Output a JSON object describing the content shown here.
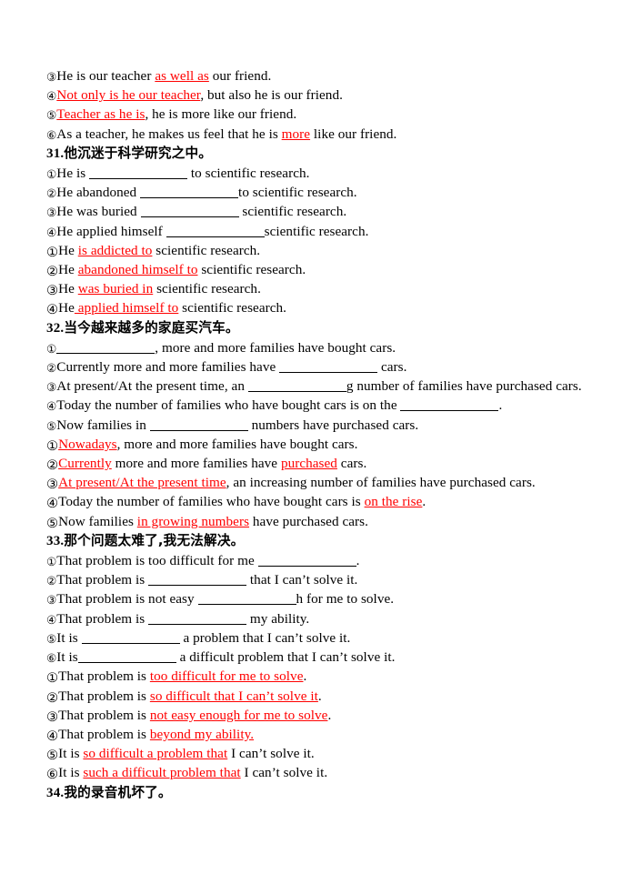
{
  "document": {
    "title": "English sentence pattern transformation worksheet",
    "accent_red": "#ff0000",
    "text_color": "#000000",
    "background": "#ffffff"
  },
  "markers": {
    "c1": "①",
    "c2": "②",
    "c3": "③",
    "c4": "④",
    "c5": "⑤",
    "c6": "⑥"
  },
  "blocks": {
    "carryover": {
      "lines": [
        {
          "marker": "③",
          "parts": [
            {
              "text": "He is our teacher ",
              "style": "plain"
            },
            {
              "text": "as well as",
              "style": "red-underline"
            },
            {
              "text": " our friend.",
              "style": "plain"
            }
          ]
        },
        {
          "marker": "④",
          "parts": [
            {
              "text": "Not only is he our teacher",
              "style": "red-underline"
            },
            {
              "text": ", but also he is our friend.",
              "style": "plain"
            }
          ]
        },
        {
          "marker": "⑤",
          "parts": [
            {
              "text": "Teacher as he is",
              "style": "red-underline"
            },
            {
              "text": ", he is more like our friend.",
              "style": "plain"
            }
          ]
        },
        {
          "marker": "⑥",
          "parts": [
            {
              "text": "As a teacher, he makes us feel that he is ",
              "style": "plain"
            },
            {
              "text": "more",
              "style": "red-underline"
            },
            {
              "text": " like our friend.",
              "style": "plain"
            }
          ]
        }
      ]
    },
    "q31": {
      "heading_number": "31.",
      "heading_text": "他沉迷于科学研究之中。",
      "questions": [
        {
          "marker": "①",
          "parts": [
            {
              "text": "He is ",
              "style": "plain"
            },
            {
              "text": "",
              "style": "blank-lg"
            },
            {
              "text": " to scientific research.",
              "style": "plain"
            }
          ]
        },
        {
          "marker": "②",
          "parts": [
            {
              "text": "He abandoned ",
              "style": "plain"
            },
            {
              "text": "",
              "style": "blank-lg"
            },
            {
              "text": "to scientific research.",
              "style": "plain"
            }
          ]
        },
        {
          "marker": "③",
          "parts": [
            {
              "text": "He was buried ",
              "style": "plain"
            },
            {
              "text": "",
              "style": "blank-lg"
            },
            {
              "text": " scientific research.",
              "style": "plain"
            }
          ]
        },
        {
          "marker": "④",
          "parts": [
            {
              "text": "He applied himself ",
              "style": "plain"
            },
            {
              "text": "",
              "style": "blank-lg"
            },
            {
              "text": "scientific research.",
              "style": "plain"
            }
          ]
        }
      ],
      "answers": [
        {
          "marker": "①",
          "parts": [
            {
              "text": "He ",
              "style": "plain"
            },
            {
              "text": "is addicted to",
              "style": "red-underline"
            },
            {
              "text": " scientific research.",
              "style": "plain"
            }
          ]
        },
        {
          "marker": "②",
          "parts": [
            {
              "text": "He ",
              "style": "plain"
            },
            {
              "text": "abandoned himself to",
              "style": "red-underline"
            },
            {
              "text": " scientific research.",
              "style": "plain"
            }
          ]
        },
        {
          "marker": "③",
          "parts": [
            {
              "text": "He ",
              "style": "plain"
            },
            {
              "text": "was buried in",
              "style": "red-underline"
            },
            {
              "text": " scientific research.",
              "style": "plain"
            }
          ]
        },
        {
          "marker": "④",
          "parts": [
            {
              "text": "He",
              "style": "plain"
            },
            {
              "text": " applied himself to",
              "style": "red-underline"
            },
            {
              "text": " scientific research.",
              "style": "plain"
            }
          ]
        }
      ]
    },
    "q32": {
      "heading_number": "32.",
      "heading_text": "当今越来越多的家庭买汽车。",
      "questions": [
        {
          "marker": "①",
          "parts": [
            {
              "text": "",
              "style": "blank-lg"
            },
            {
              "text": ", more and more families have bought cars.",
              "style": "plain"
            }
          ]
        },
        {
          "marker": "②",
          "parts": [
            {
              "text": "Currently more and more families have ",
              "style": "plain"
            },
            {
              "text": "",
              "style": "blank-lg"
            },
            {
              "text": " cars.",
              "style": "plain"
            }
          ]
        },
        {
          "marker": "③",
          "parts": [
            {
              "text": "At present/At the present time, an ",
              "style": "plain"
            },
            {
              "text": "",
              "style": "blank-lg"
            },
            {
              "text": "g number of families have purchased cars.",
              "style": "plain"
            }
          ]
        },
        {
          "marker": "④",
          "parts": [
            {
              "text": "Today the number of families who have bought cars is on the ",
              "style": "plain"
            },
            {
              "text": "",
              "style": "blank-lg"
            },
            {
              "text": ".",
              "style": "plain"
            }
          ]
        },
        {
          "marker": "⑤",
          "parts": [
            {
              "text": "Now families in ",
              "style": "plain"
            },
            {
              "text": "",
              "style": "blank-lg"
            },
            {
              "text": " numbers have purchased cars.",
              "style": "plain"
            }
          ]
        }
      ],
      "answers": [
        {
          "marker": "①",
          "parts": [
            {
              "text": "Nowadays",
              "style": "red-underline"
            },
            {
              "text": ", more and more families have bought cars.",
              "style": "plain"
            }
          ]
        },
        {
          "marker": "②",
          "parts": [
            {
              "text": "Currently",
              "style": "red-underline"
            },
            {
              "text": " more and more families have ",
              "style": "plain"
            },
            {
              "text": "purchased",
              "style": "red-underline"
            },
            {
              "text": " cars.",
              "style": "plain"
            }
          ]
        },
        {
          "marker": "③",
          "parts": [
            {
              "text": "At present/At the present time",
              "style": "red-underline"
            },
            {
              "text": ", an increasing number of families have purchased cars.",
              "style": "plain"
            }
          ]
        },
        {
          "marker": "④",
          "parts": [
            {
              "text": "Today the number of families who have bought cars is ",
              "style": "plain"
            },
            {
              "text": "on the rise",
              "style": "red-underline"
            },
            {
              "text": ".",
              "style": "plain"
            }
          ]
        },
        {
          "marker": "⑤",
          "parts": [
            {
              "text": "Now families ",
              "style": "plain"
            },
            {
              "text": "in growing numbers",
              "style": "red-underline"
            },
            {
              "text": " have purchased cars.",
              "style": "plain"
            }
          ]
        }
      ]
    },
    "q33": {
      "heading_number": "33.",
      "heading_text": "那个问题太难了,我无法解决。",
      "questions": [
        {
          "marker": "①",
          "parts": [
            {
              "text": "That problem is too difficult for me ",
              "style": "plain"
            },
            {
              "text": "",
              "style": "blank-lg"
            },
            {
              "text": ".",
              "style": "plain"
            }
          ]
        },
        {
          "marker": "②",
          "parts": [
            {
              "text": "That problem is ",
              "style": "plain"
            },
            {
              "text": "",
              "style": "blank-lg"
            },
            {
              "text": " that I can’t solve it.",
              "style": "plain"
            }
          ]
        },
        {
          "marker": "③",
          "parts": [
            {
              "text": "That problem is not easy ",
              "style": "plain"
            },
            {
              "text": "",
              "style": "blank-lg"
            },
            {
              "text": "h for me to solve.",
              "style": "plain"
            }
          ]
        },
        {
          "marker": "④",
          "parts": [
            {
              "text": "That problem is ",
              "style": "plain"
            },
            {
              "text": "",
              "style": "blank-lg"
            },
            {
              "text": " my ability.",
              "style": "plain"
            }
          ]
        },
        {
          "marker": "⑤",
          "parts": [
            {
              "text": "It is ",
              "style": "plain"
            },
            {
              "text": "",
              "style": "blank-lg"
            },
            {
              "text": " a problem that I can’t solve it.",
              "style": "plain"
            }
          ]
        },
        {
          "marker": "⑥",
          "parts": [
            {
              "text": "It is",
              "style": "plain"
            },
            {
              "text": "",
              "style": "blank-lg"
            },
            {
              "text": " a difficult problem that I can’t solve it.",
              "style": "plain"
            }
          ]
        }
      ],
      "answers": [
        {
          "marker": "①",
          "parts": [
            {
              "text": "That problem is ",
              "style": "plain"
            },
            {
              "text": "too difficult for me to solve",
              "style": "red-underline"
            },
            {
              "text": ".",
              "style": "plain"
            }
          ]
        },
        {
          "marker": "②",
          "parts": [
            {
              "text": "That problem is ",
              "style": "plain"
            },
            {
              "text": "so difficult that I can’t solve it",
              "style": "red-underline"
            },
            {
              "text": ".",
              "style": "plain"
            }
          ]
        },
        {
          "marker": "③",
          "parts": [
            {
              "text": "That problem is ",
              "style": "plain"
            },
            {
              "text": "not easy enough for me to solve",
              "style": "red-underline"
            },
            {
              "text": ".",
              "style": "plain"
            }
          ]
        },
        {
          "marker": "④",
          "parts": [
            {
              "text": "That problem is ",
              "style": "plain"
            },
            {
              "text": "beyond my ability.",
              "style": "red-underline"
            }
          ]
        },
        {
          "marker": "⑤",
          "parts": [
            {
              "text": "It is ",
              "style": "plain"
            },
            {
              "text": "so difficult a problem that",
              "style": "red-underline"
            },
            {
              "text": " I can’t solve it.",
              "style": "plain"
            }
          ]
        },
        {
          "marker": "⑥",
          "parts": [
            {
              "text": "It is ",
              "style": "plain"
            },
            {
              "text": "such a difficult problem that",
              "style": "red-underline"
            },
            {
              "text": " I can’t solve it.",
              "style": "plain"
            }
          ]
        }
      ]
    },
    "q34": {
      "heading_number": "34.",
      "heading_text": "我的录音机坏了。"
    }
  }
}
